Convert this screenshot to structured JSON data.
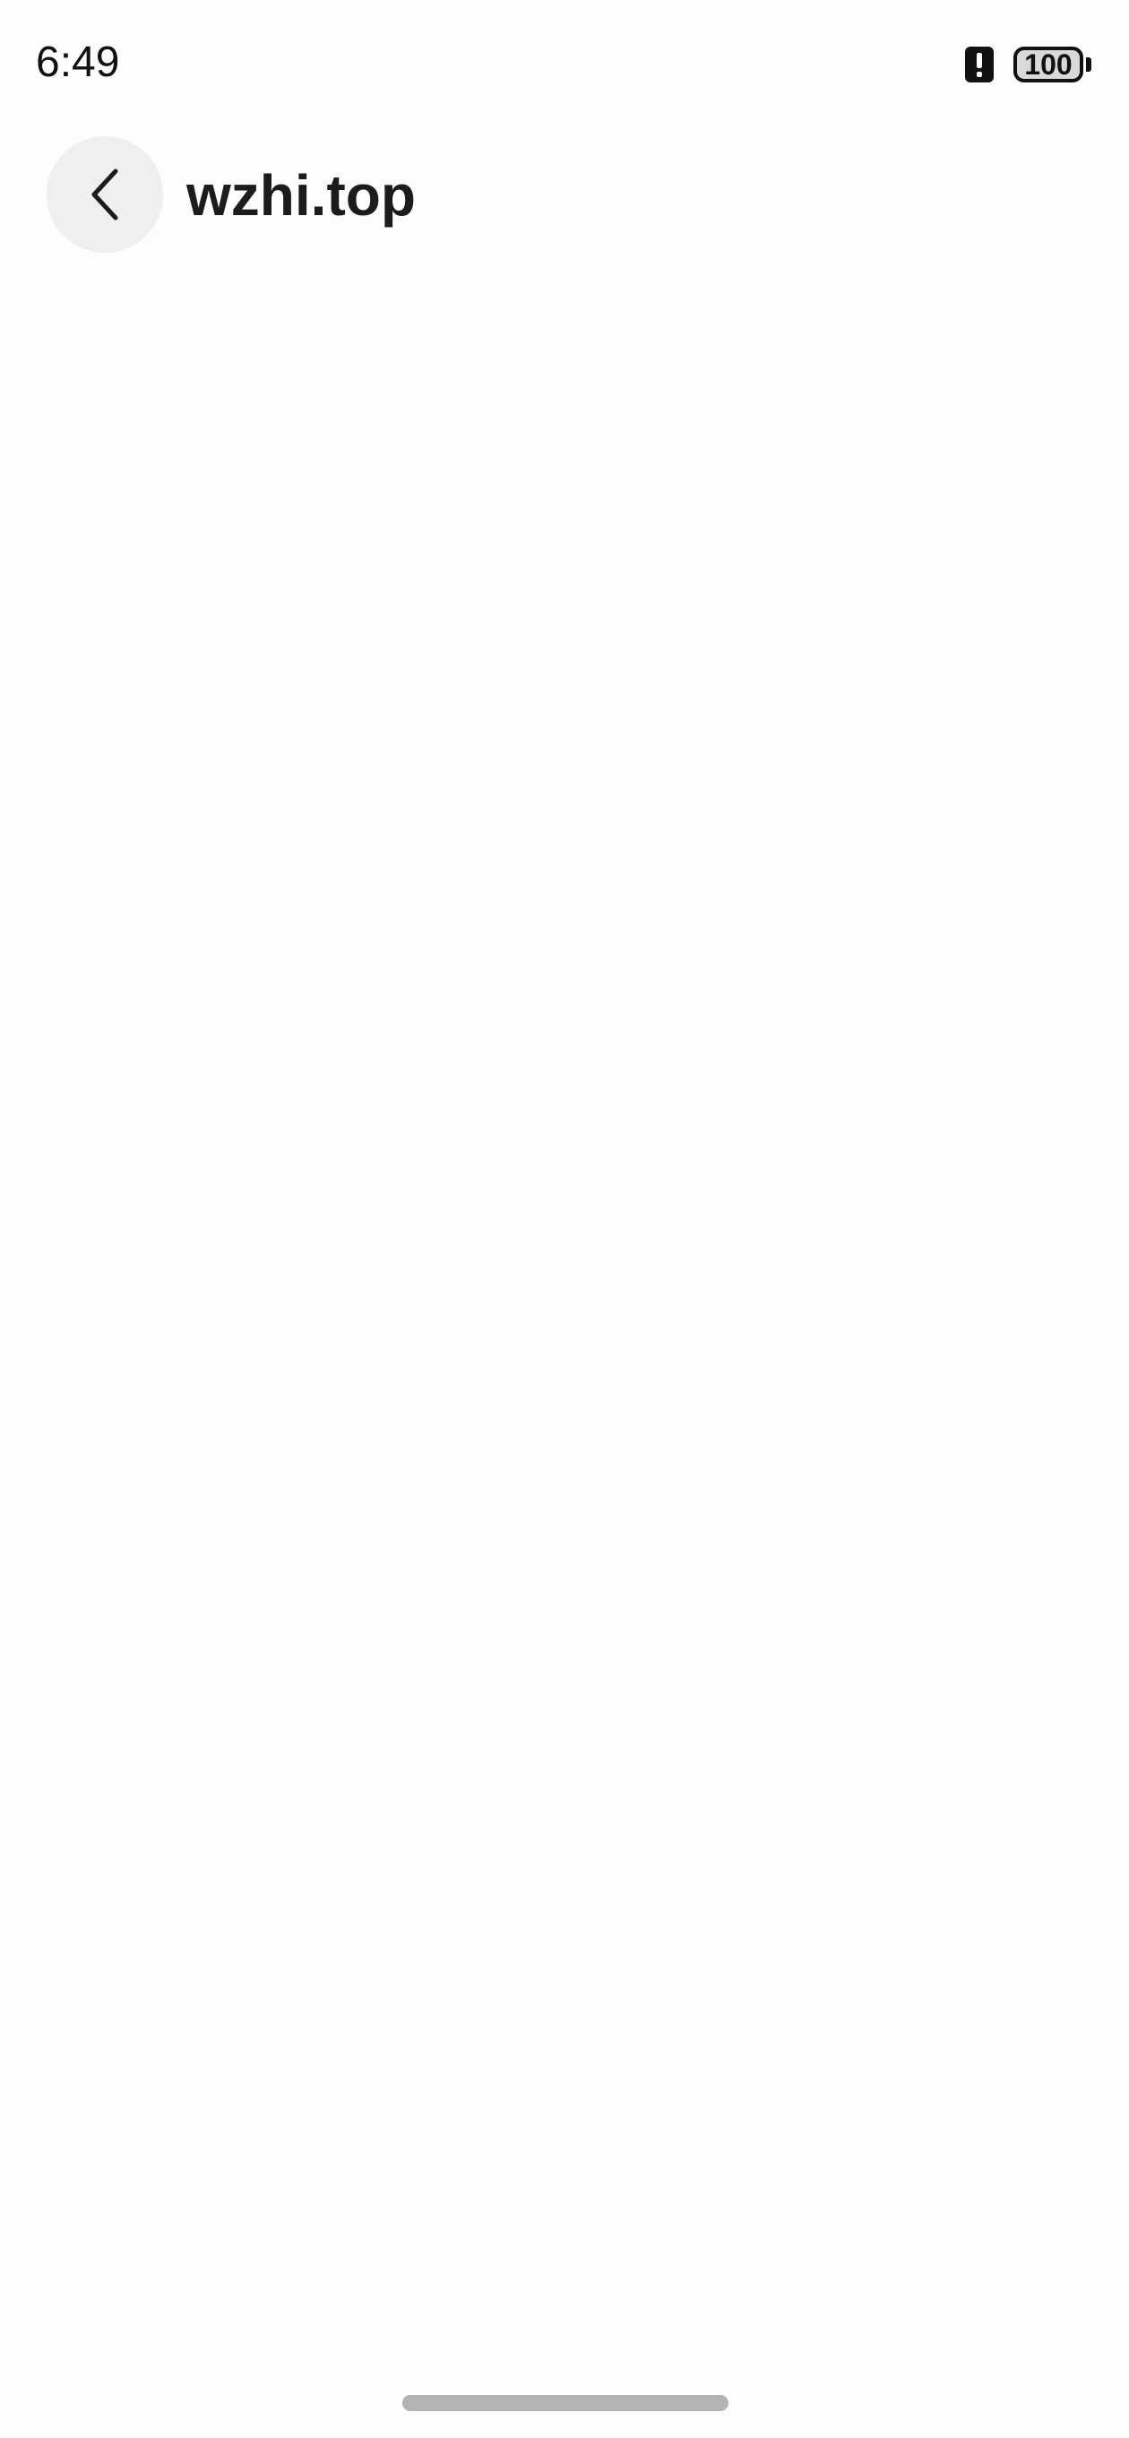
{
  "status_bar": {
    "time": "6:49",
    "alert_icon": "alert-icon",
    "battery_level": "100",
    "battery_icon": "battery-icon"
  },
  "header": {
    "back_icon": "chevron-left-icon",
    "title": "wzhi.top"
  },
  "colors": {
    "background": "#fdfdfd",
    "back_button_bg": "#efefef",
    "text": "#1c1c1c",
    "home_indicator": "#b3b3b3"
  }
}
